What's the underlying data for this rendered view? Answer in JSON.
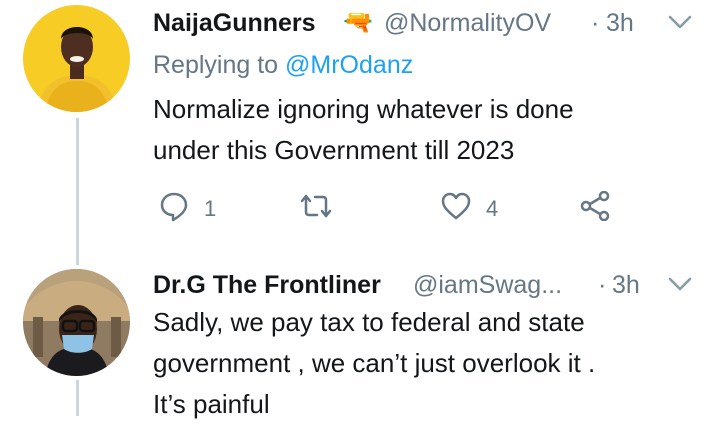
{
  "tweets": [
    {
      "display_name": "NaijaGunners",
      "name_emoji": "🔫",
      "handle": "@NormalityOV",
      "separator": "·",
      "time": "3h",
      "reply_prefix": "Replying to",
      "reply_to": "@MrOdanz",
      "text_lines": [
        "Normalize ignoring whatever is done",
        "under this Government till 2023"
      ],
      "actions": {
        "reply_count": "1",
        "retweet_count": "",
        "like_count": "4"
      }
    },
    {
      "display_name": "Dr.G The Frontliner",
      "handle": "@iamSwag...",
      "separator": "·",
      "time": "3h",
      "text_lines": [
        "Sadly, we pay tax to federal and state",
        "government , we can’t just overlook it .",
        "It’s painful"
      ]
    }
  ],
  "colors": {
    "secondary_text": "#657786",
    "link": "#1da1f2",
    "thread_line": "#ccd6dd"
  },
  "icons": [
    "reply-icon",
    "retweet-icon",
    "like-icon",
    "share-icon",
    "chevron-down-icon"
  ]
}
